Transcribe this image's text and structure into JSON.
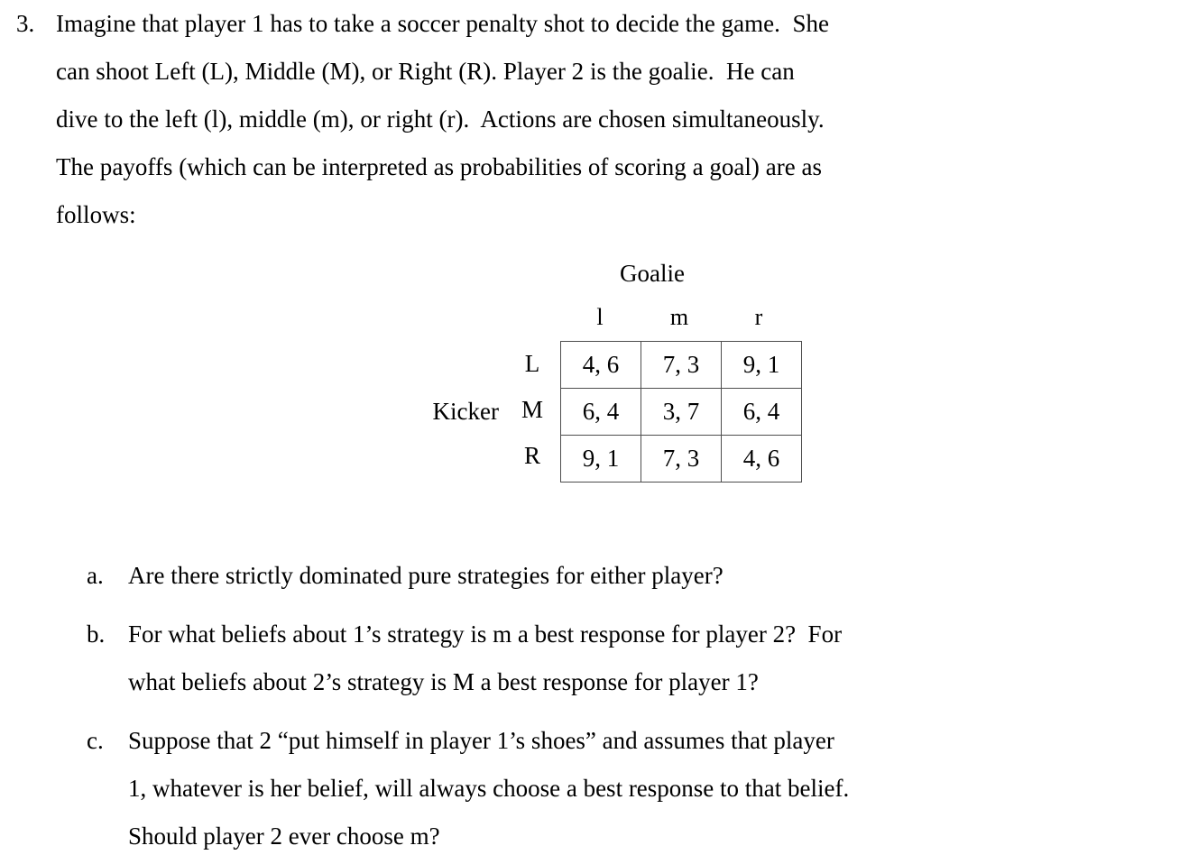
{
  "problem": {
    "marker": "3.",
    "lines": [
      "Imagine that player 1 has to take a soccer penalty shot to decide the game.  She",
      "can shoot Left (L), Middle (M), or Right (R). Player 2 is the goalie.  He can",
      "dive to the left (l), middle (m), or right (r).  Actions are chosen simultaneously.",
      "The payoffs (which can be interpreted as probabilities of scoring a goal) are as",
      "follows:"
    ]
  },
  "matrix": {
    "column_player": "Goalie",
    "row_player": "Kicker",
    "column_headers": [
      "l",
      "m",
      "r"
    ],
    "row_headers": [
      "L",
      "M",
      "R"
    ],
    "cells": [
      [
        "4, 6",
        "7, 3",
        "9, 1"
      ],
      [
        "6, 4",
        "3, 7",
        "6, 4"
      ],
      [
        "9, 1",
        "7, 3",
        "4, 6"
      ]
    ],
    "border_color": "#4d4d4d"
  },
  "subquestions": [
    {
      "marker": "a.",
      "lines": [
        "Are there strictly dominated pure strategies for either player?"
      ]
    },
    {
      "marker": "b.",
      "lines": [
        "For what beliefs about 1’s strategy is m a best response for player 2?  For",
        "what beliefs about 2’s strategy is M a best response for player 1?"
      ]
    },
    {
      "marker": "c.",
      "lines": [
        "Suppose that 2 “put himself in player 1’s shoes” and assumes that player",
        "1, whatever is her belief, will always choose a best response to that belief.",
        "Should player 2 ever choose m?"
      ]
    }
  ]
}
